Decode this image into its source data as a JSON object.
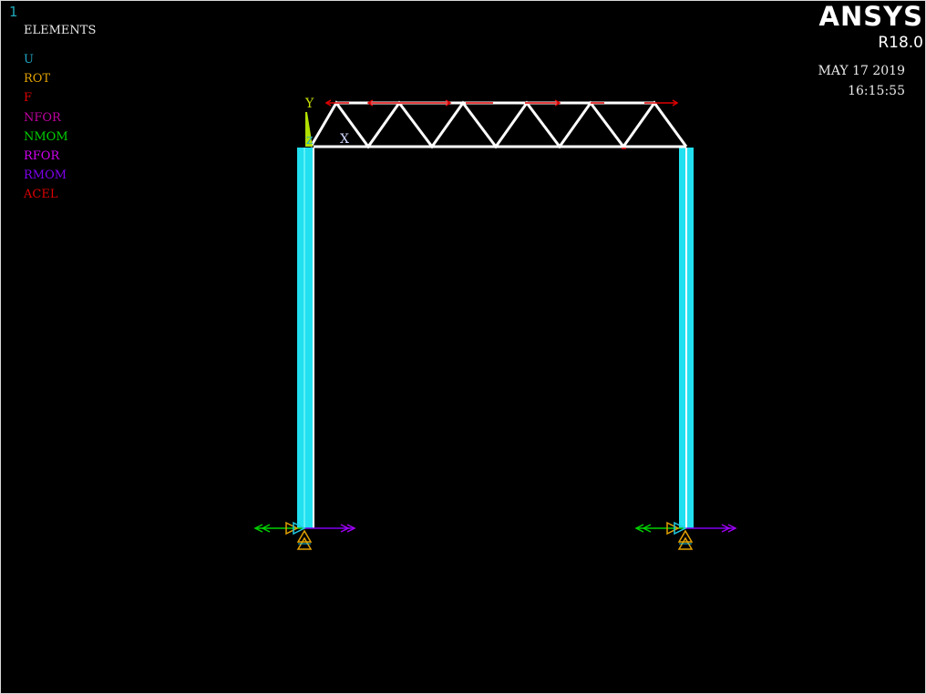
{
  "window_number": "1",
  "legend": {
    "title": "ELEMENTS",
    "items": [
      {
        "label": "U",
        "color": "#1fa8c8"
      },
      {
        "label": "ROT",
        "color": "#e0a000"
      },
      {
        "label": "F",
        "color": "#e00000"
      },
      {
        "label": "NFOR",
        "color": "#c000a0"
      },
      {
        "label": "NMOM",
        "color": "#00d000"
      },
      {
        "label": "RFOR",
        "color": "#d000f0"
      },
      {
        "label": "RMOM",
        "color": "#8000f0"
      },
      {
        "label": "ACEL",
        "color": "#e00000"
      }
    ]
  },
  "brand": {
    "logo": "ANSYS",
    "version": "R18.0"
  },
  "date": "MAY 17 2019",
  "time": "16:15:55",
  "axes": {
    "y": "Y",
    "x": "X",
    "z": "Z"
  }
}
